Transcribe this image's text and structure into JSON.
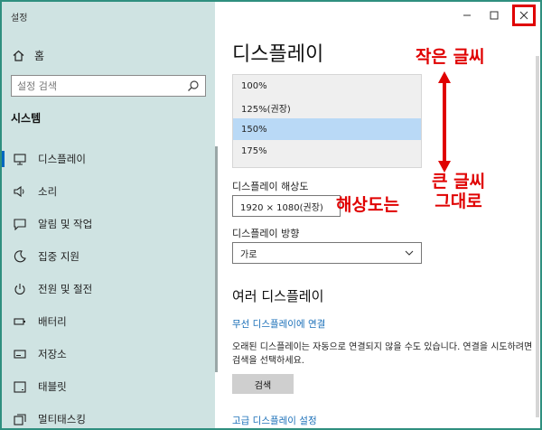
{
  "window": {
    "title": "설정"
  },
  "sidebar": {
    "home_label": "홈",
    "search_placeholder": "설정 검색",
    "section": "시스템",
    "items": [
      {
        "label": "디스플레이",
        "icon": "monitor-icon",
        "active": true
      },
      {
        "label": "소리",
        "icon": "speaker-icon"
      },
      {
        "label": "알림 및 작업",
        "icon": "notification-icon"
      },
      {
        "label": "집중 지원",
        "icon": "moon-icon"
      },
      {
        "label": "전원 및 절전",
        "icon": "power-icon"
      },
      {
        "label": "배터리",
        "icon": "battery-icon"
      },
      {
        "label": "저장소",
        "icon": "storage-icon"
      },
      {
        "label": "태블릿",
        "icon": "tablet-icon"
      },
      {
        "label": "멀티태스킹",
        "icon": "multitasking-icon"
      }
    ]
  },
  "content": {
    "title": "디스플레이",
    "scale_options": [
      "100%",
      "125%(권장)",
      "150%",
      "175%"
    ],
    "scale_selected_index": 2,
    "resolution_label": "디스플레이 해상도",
    "resolution_value": "1920 × 1080(권장)",
    "orientation_label": "디스플레이 방향",
    "orientation_value": "가로",
    "multi_heading": "여러 디스플레이",
    "wireless_link": "무선 디스플레이에 연결",
    "desc": "오래된 디스플레이는 자동으로 연결되지 않을 수도 있습니다. 연결을 시도하려면 검색을 선택하세요.",
    "detect_button": "검색",
    "advanced_link": "고급 디스플레이 설정"
  },
  "annotations": {
    "small_text": "작은 글씨",
    "big_text_1": "큰 글씨",
    "big_text_2": "그대로",
    "resolution_note": "해상도는",
    "color": "#e00000"
  }
}
